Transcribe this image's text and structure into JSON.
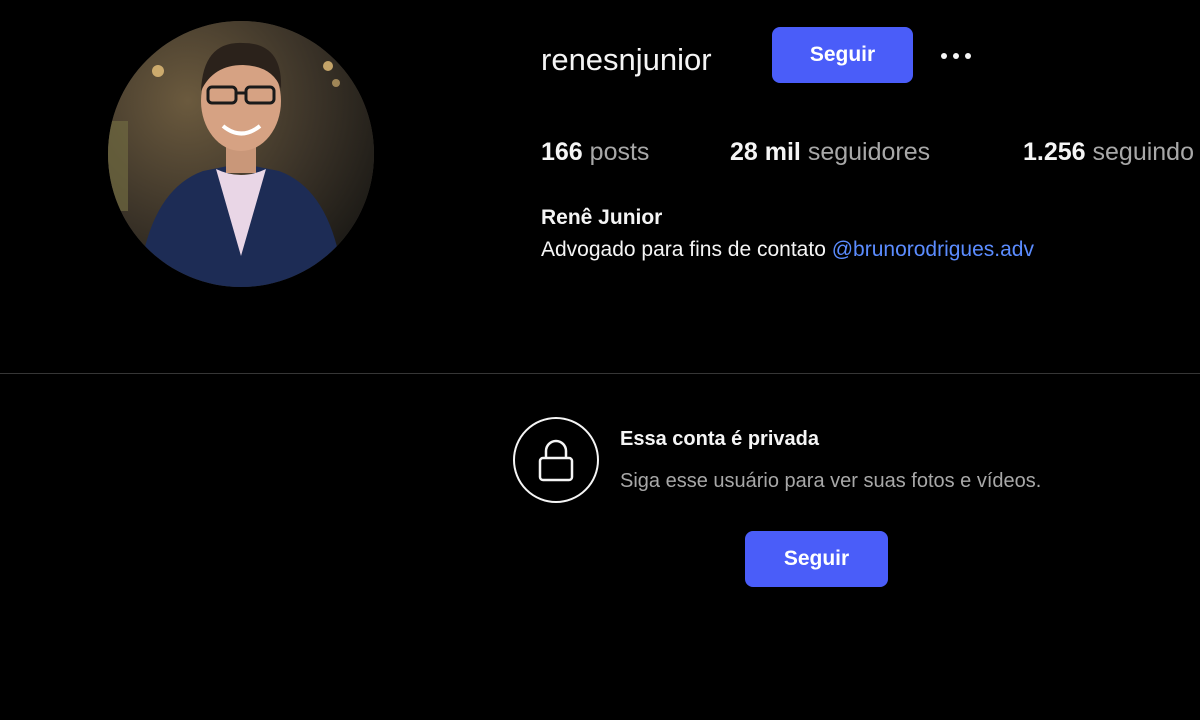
{
  "profile": {
    "username": "renesnjunior",
    "avatar_icon": "profile-photo",
    "follow_label": "Seguir",
    "more_icon": "more-horizontal-icon",
    "stats": {
      "posts_count": "166",
      "posts_label": "posts",
      "followers_count": "28 mil",
      "followers_label": "seguidores",
      "following_count": "1.256",
      "following_label": "seguindo"
    },
    "full_name": "Renê Junior",
    "bio_text": "Advogado para fins de contato",
    "bio_mention": "@brunorodrigues.adv"
  },
  "private_notice": {
    "icon": "lock-icon",
    "title": "Essa conta é privada",
    "subtitle": "Siga esse usuário para ver suas fotos e vídeos.",
    "follow_label": "Seguir"
  },
  "colors": {
    "background": "#000000",
    "primary_button": "#4a5df9",
    "link": "#5b8cff",
    "muted_text": "#a8a8a8"
  }
}
